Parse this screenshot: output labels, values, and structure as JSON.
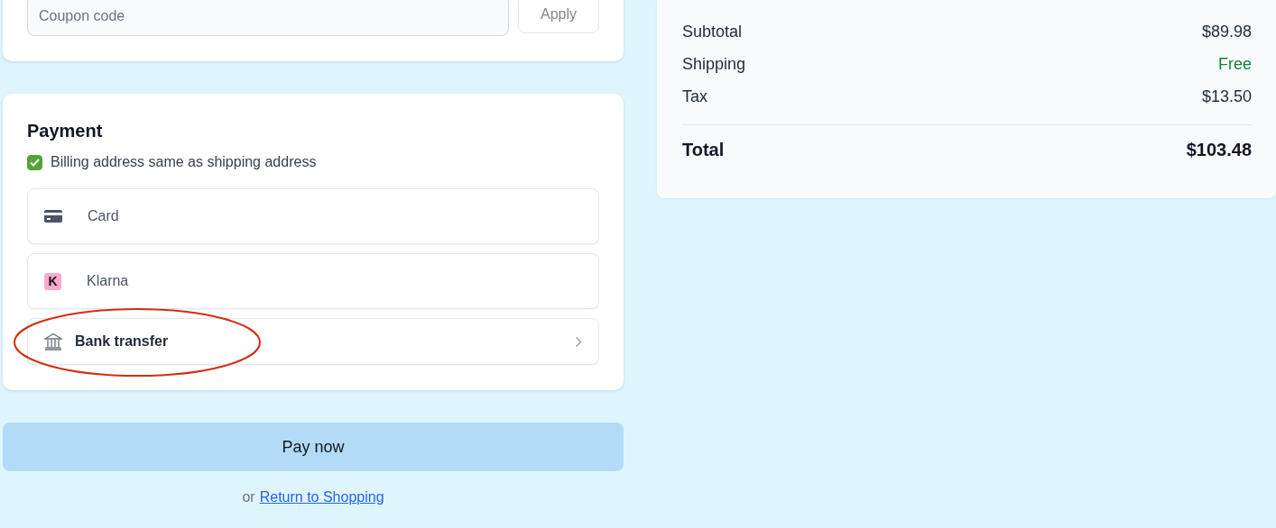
{
  "coupon": {
    "placeholder": "Coupon code",
    "button": "Apply"
  },
  "payment": {
    "title": "Payment",
    "billing_same": {
      "label": "Billing address same as shipping address",
      "checked": true
    },
    "methods": [
      {
        "kind": "card",
        "label": "Card",
        "annotated": false
      },
      {
        "kind": "klarna",
        "label": "Klarna",
        "icon_text": "K",
        "annotated": false
      },
      {
        "kind": "bank",
        "label": "Bank transfer",
        "annotated": true
      }
    ]
  },
  "pay_button": "Pay now",
  "return": {
    "prefix": "or",
    "link": "Return to Shopping"
  },
  "summary": {
    "rows": [
      {
        "kind": "line",
        "label": "Subtotal",
        "value": "$89.98"
      },
      {
        "kind": "line",
        "label": "Shipping",
        "value": "Free",
        "color": "#15803d"
      },
      {
        "kind": "line",
        "label": "Tax",
        "value": "$13.50"
      },
      {
        "kind": "total",
        "label": "Total",
        "value": "$103.48"
      }
    ]
  }
}
